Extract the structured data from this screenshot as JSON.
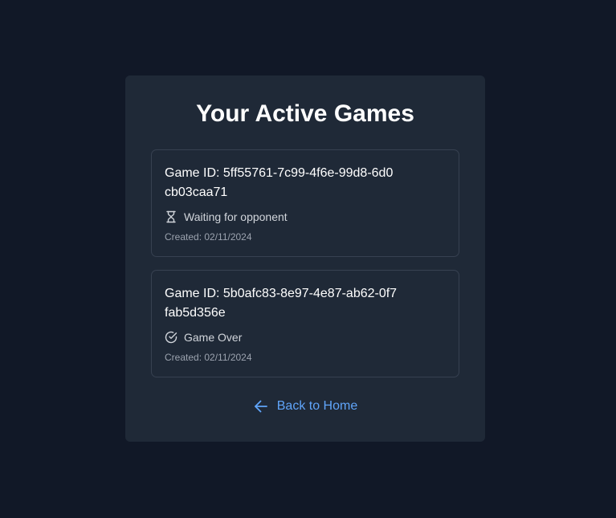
{
  "page": {
    "title": "Your Active Games"
  },
  "games": [
    {
      "id_label": "Game ID: 5ff55761-7c99-4f6e-99d8-6d0cb03caa71",
      "status_icon": "hourglass-icon",
      "status": "Waiting for opponent",
      "created": "Created: 02/11/2024"
    },
    {
      "id_label": "Game ID: 5b0afc83-8e97-4e87-ab62-0f7fab5d356e",
      "status_icon": "check-circle-icon",
      "status": "Game Over",
      "created": "Created: 02/11/2024"
    }
  ],
  "back_link": {
    "label": "Back to Home",
    "icon": "arrow-left-icon"
  },
  "colors": {
    "background": "#111827",
    "panel": "#1f2937",
    "card_border": "#374151",
    "link": "#60a5fa"
  }
}
